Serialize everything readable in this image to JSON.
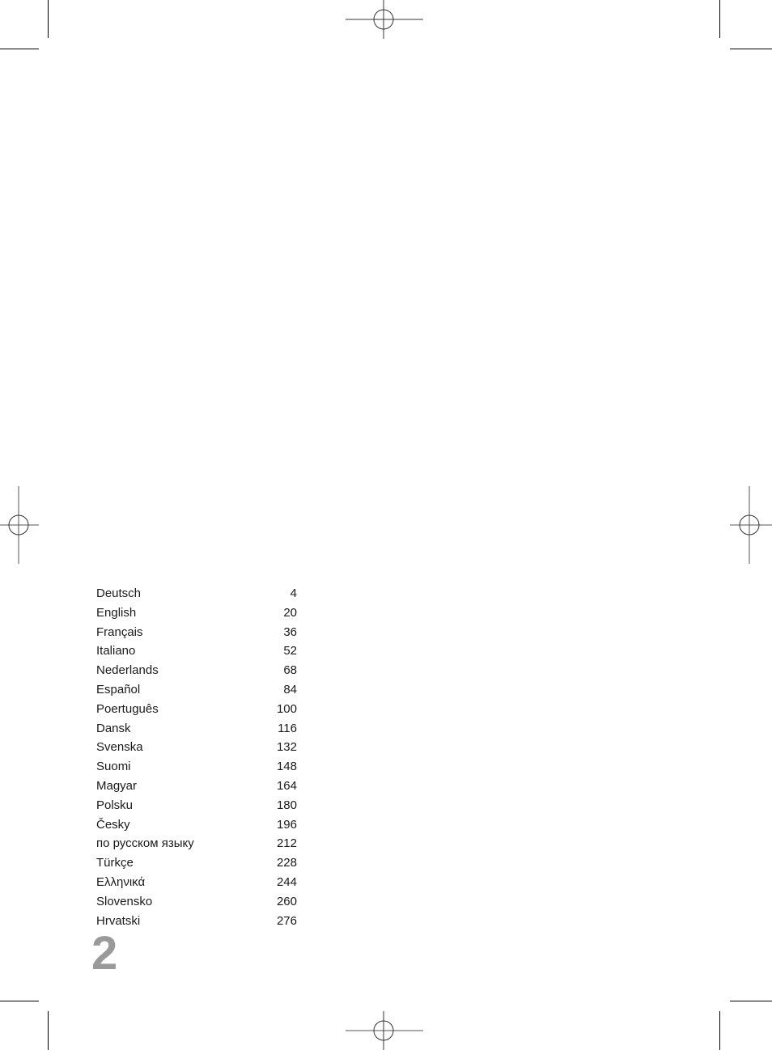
{
  "toc": {
    "entries": [
      {
        "language": "Deutsch",
        "page": "4"
      },
      {
        "language": "English",
        "page": "20"
      },
      {
        "language": "Français",
        "page": "36"
      },
      {
        "language": "Italiano",
        "page": "52"
      },
      {
        "language": "Nederlands",
        "page": "68"
      },
      {
        "language": "Español",
        "page": "84"
      },
      {
        "language": "Poertuguês",
        "page": "100"
      },
      {
        "language": "Dansk",
        "page": "116"
      },
      {
        "language": "Svenska",
        "page": "132"
      },
      {
        "language": "Suomi",
        "page": "148"
      },
      {
        "language": "Magyar",
        "page": "164"
      },
      {
        "language": "Polsku",
        "page": "180"
      },
      {
        "language": "Česky",
        "page": "196"
      },
      {
        "language": "по русском языку",
        "page": "212"
      },
      {
        "language": "Türkçe",
        "page": "228"
      },
      {
        "language": "Ελληνικά",
        "page": "244"
      },
      {
        "language": "Slovensko",
        "page": "260"
      },
      {
        "language": "Hrvatski",
        "page": "276"
      }
    ]
  },
  "page_number": "2"
}
